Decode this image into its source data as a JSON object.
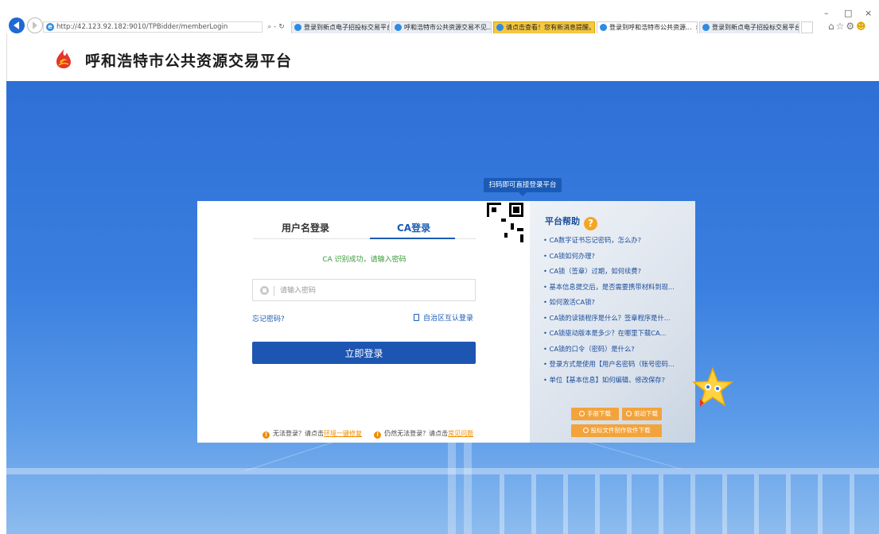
{
  "browser": {
    "url": "http://42.123.92.182:9010/TPBidder/memberLogin",
    "address_tools": "⌕ - ↻",
    "tabs": [
      {
        "label": "登录到新点电子招投标交易平台",
        "state": "normal"
      },
      {
        "label": "呼和浩特市公共资源交易不见...",
        "state": "normal"
      },
      {
        "label": "请点击查看！您有新消息提醒。",
        "state": "warning"
      },
      {
        "label": "登录到呼和浩特市公共资源...",
        "state": "active",
        "close": "×"
      },
      {
        "label": "登录到新点电子招投标交易平台",
        "state": "normal"
      }
    ],
    "window_controls": {
      "minimize": "–",
      "maximize": "□",
      "close": "×"
    },
    "toolbar_icons": [
      "home-icon",
      "star-icon",
      "gear-icon",
      "smiley-icon"
    ]
  },
  "site": {
    "title": "呼和浩特市公共资源交易平台",
    "logo_icon": "flame-logo-icon"
  },
  "login": {
    "tabs": {
      "username": "用户名登录",
      "ca": "CA登录"
    },
    "active_tab": "ca",
    "ca_message": "CA 识别成功，请输入密码",
    "password_placeholder": "请输入密码",
    "forgot_password": "忘记密码?",
    "region_login": "自治区互认登录",
    "submit": "立即登录",
    "help_line": {
      "text1": "无法登录？请点击",
      "link1": "环境一键修复",
      "text2": "仍然无法登录？请点击",
      "link2": "常见问题"
    },
    "qr_tip": "扫码即可直接登录平台"
  },
  "help_panel": {
    "title": "平台帮助",
    "items": [
      "CA数字证书忘记密码，怎么办?",
      "CA锁如何办理?",
      "CA锁（签章）过期，如何续费?",
      "基本信息提交后，是否需要携带材料到现...",
      "如何激活CA锁?",
      "CA锁的读锁程序是什么？签章程序是什...",
      "CA锁驱动版本是多少？在哪里下载CA...",
      "CA锁的口令（密码）是什么?",
      "登录方式是使用【用户名密码（账号密码...",
      "单位【基本信息】如何编辑、修改保存?"
    ],
    "downloads": {
      "manual": "手册下载",
      "driver": "驱动下载",
      "bid_tool": "投标文件制作软件下载"
    }
  },
  "colors": {
    "primary": "#1d55b2",
    "accent": "#f3a33b",
    "success": "#3a9a3a",
    "background": "#3a7fe0"
  }
}
